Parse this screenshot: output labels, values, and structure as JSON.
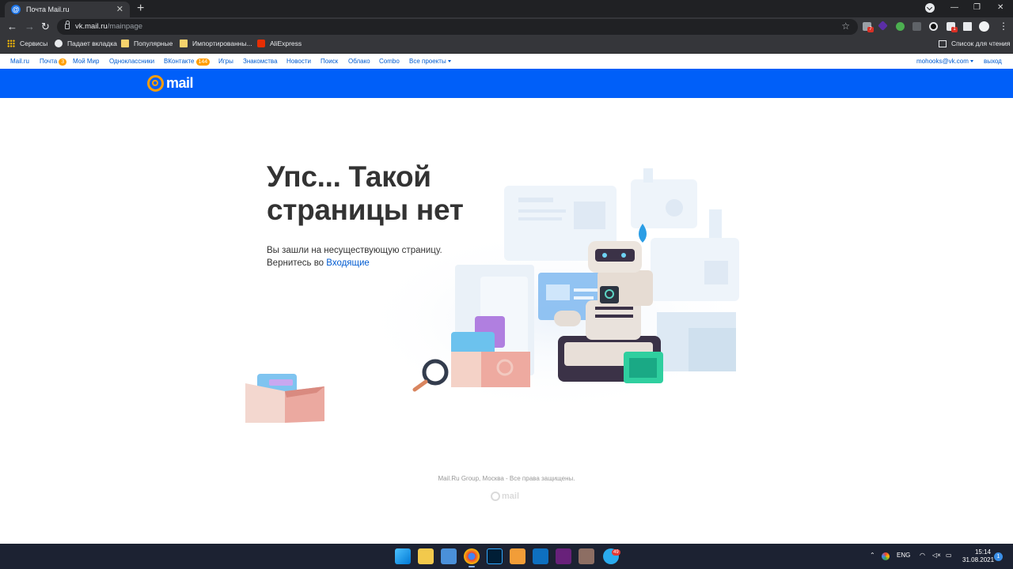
{
  "browser": {
    "tab_title": "Почта Mail.ru",
    "url_host": "vk.mail.ru",
    "url_path": "/mainpage",
    "bookmarks": [
      "Сервисы",
      "Падает вкладка",
      "Популярные",
      "Импортированны...",
      "AliExpress"
    ],
    "reading_list": "Список для чтения",
    "ext_badges": [
      "7",
      "1"
    ]
  },
  "portal": {
    "items": [
      "Mail.ru",
      "Почта",
      "Мой Мир",
      "Одноклассники",
      "ВКонтакте",
      "Игры",
      "Знакомства",
      "Новости",
      "Поиск",
      "Облако",
      "Combo",
      "Все проекты"
    ],
    "mail_badge": "3",
    "vk_badge": "144",
    "user": "mohooks@vk.com",
    "logout": "выход"
  },
  "header": {
    "logo_text": "mail"
  },
  "content": {
    "title": "Упс... Такой страницы нет",
    "line1": "Вы зашли на несуществующую страницу.",
    "line2_prefix": "Вернитесь во ",
    "line2_link": "Входящие"
  },
  "footer": {
    "copyright": "Mail.Ru Group, Москва - Все права защищены.",
    "logo_text": "mail"
  },
  "taskbar": {
    "lang": "ENG",
    "time": "15:14",
    "date": "31.08.2021",
    "notif": "1",
    "telegram_badge": "49"
  },
  "colors": {
    "header_blue": "#005ff9",
    "accent_orange": "#ff9e00",
    "link_blue": "#005bd1"
  }
}
